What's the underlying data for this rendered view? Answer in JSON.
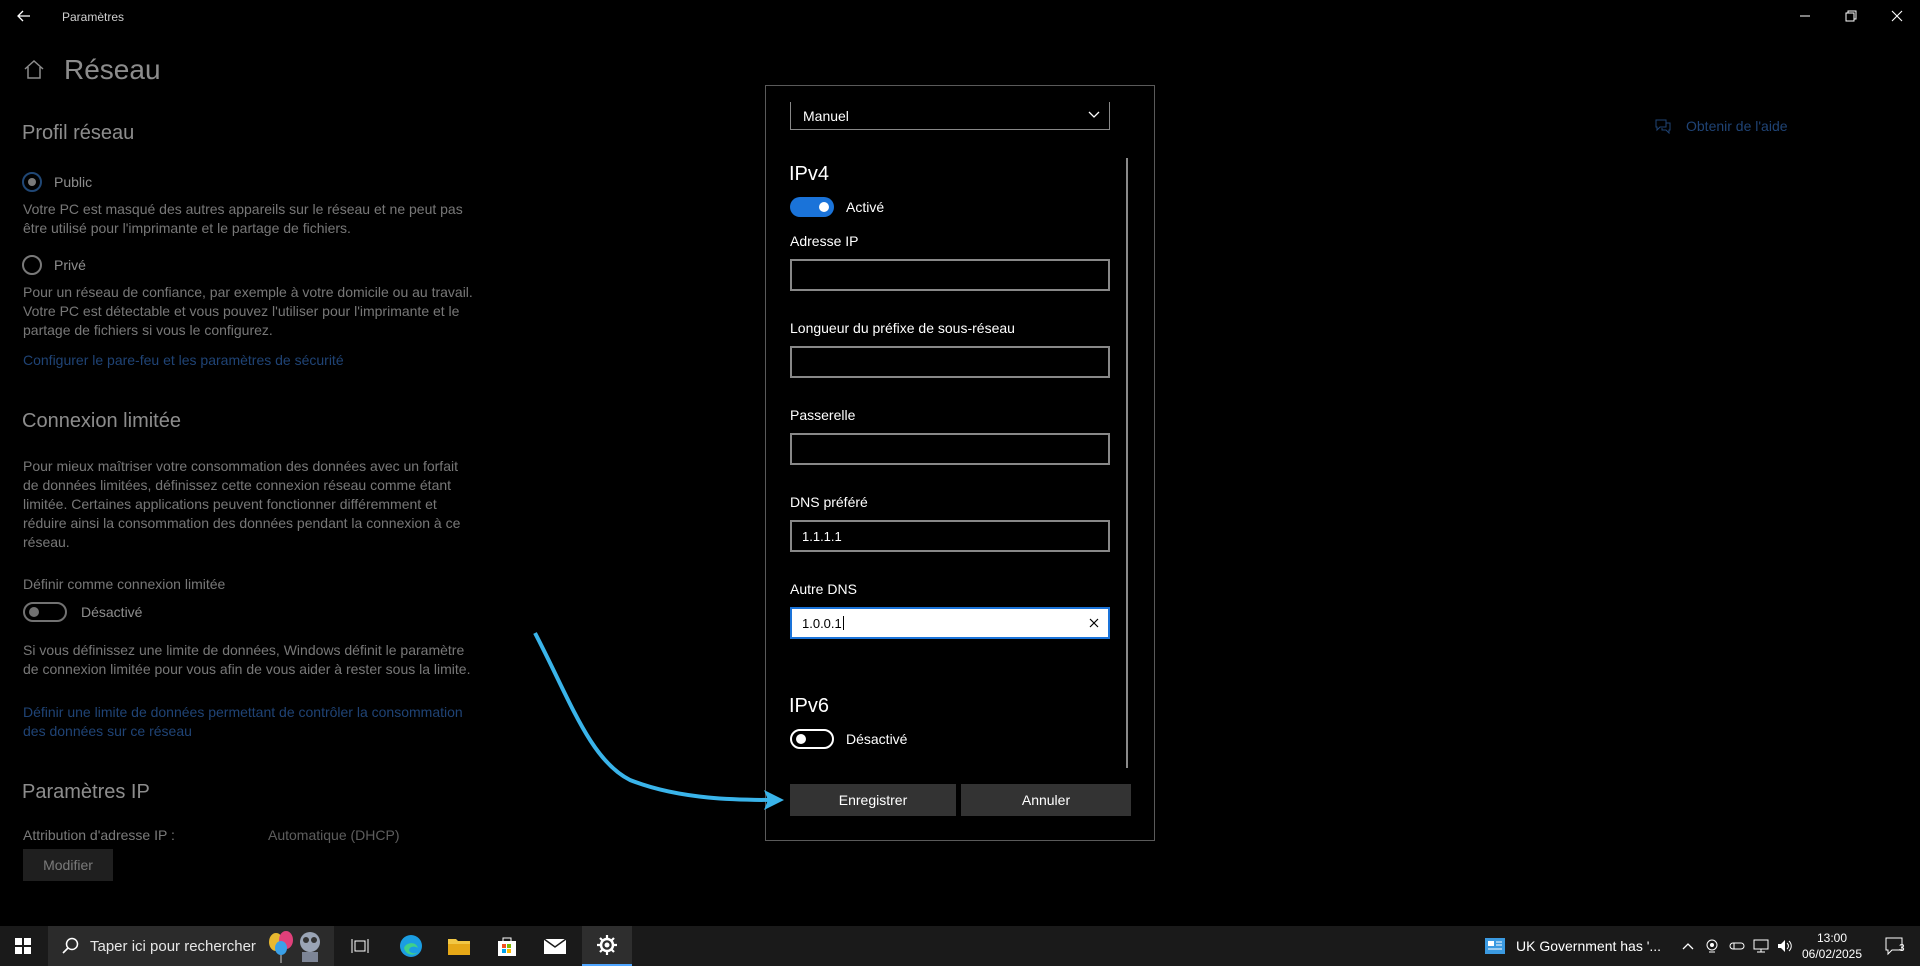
{
  "window": {
    "title": "Paramètres",
    "back_icon": "back-arrow-icon",
    "controls": [
      "minimize-icon",
      "restore-icon",
      "close-icon"
    ]
  },
  "page": {
    "title": "Réseau",
    "help_link": "Obtenir de l'aide",
    "network_profile": {
      "heading": "Profil réseau",
      "public_label": "Public",
      "public_desc_1": "Votre PC est masqué des autres appareils sur le réseau et ne peut pas",
      "public_desc_2": "être utilisé pour l'imprimante et le partage de fichiers.",
      "private_label": "Privé",
      "private_desc_1": "Pour un réseau de confiance, par exemple à votre domicile ou au travail.",
      "private_desc_2": "Votre PC est détectable et vous pouvez l'utiliser pour l'imprimante et le",
      "private_desc_3": "partage de fichiers si vous le configurez.",
      "firewall_link": "Configurer le pare-feu et les paramètres de sécurité"
    },
    "metered": {
      "heading": "Connexion limitée",
      "desc_1": "Pour mieux maîtriser votre consommation des données avec un forfait",
      "desc_2": "de données limitées, définissez cette connexion réseau comme étant",
      "desc_3": "limitée. Certaines applications peuvent fonctionner différemment et",
      "desc_4": "réduire ainsi la consommation des données pendant la connexion à ce",
      "desc_5": "réseau.",
      "toggle_title": "Définir comme connexion limitée",
      "toggle_state": "Désactivé",
      "note_1": "Si vous définissez une limite de données, Windows définit le paramètre",
      "note_2": "de connexion limitée pour vous afin de vous aider à rester sous la limite.",
      "limit_link_1": "Définir une limite de données permettant de contrôler la consommation",
      "limit_link_2": "des données sur ce réseau"
    },
    "ip_settings": {
      "heading": "Paramètres IP",
      "assignment_label": "Attribution d'adresse IP :",
      "assignment_value": "Automatique (DHCP)",
      "modify_button": "Modifier"
    }
  },
  "dialog": {
    "mode_value": "Manuel",
    "ipv4": {
      "heading": "IPv4",
      "toggle_state": "Activé",
      "ip_address_label": "Adresse IP",
      "ip_address_value": "",
      "prefix_label": "Longueur du préfixe de sous-réseau",
      "prefix_value": "",
      "gateway_label": "Passerelle",
      "gateway_value": "",
      "dns_preferred_label": "DNS préféré",
      "dns_preferred_value": "1.1.1.1",
      "dns_alt_label": "Autre DNS",
      "dns_alt_value": "1.0.0.1"
    },
    "ipv6": {
      "heading": "IPv6",
      "toggle_state": "Désactivé"
    },
    "save_button": "Enregistrer",
    "cancel_button": "Annuler"
  },
  "taskbar": {
    "search_placeholder": "Taper ici pour rechercher",
    "news_text": "UK Government has '...",
    "time": "13:00",
    "date": "06/02/2025",
    "notification_count": "3"
  },
  "colors": {
    "accent": "#1a73d9",
    "link": "#3a7bd5",
    "annotation_arrow": "#3ab4ea"
  }
}
